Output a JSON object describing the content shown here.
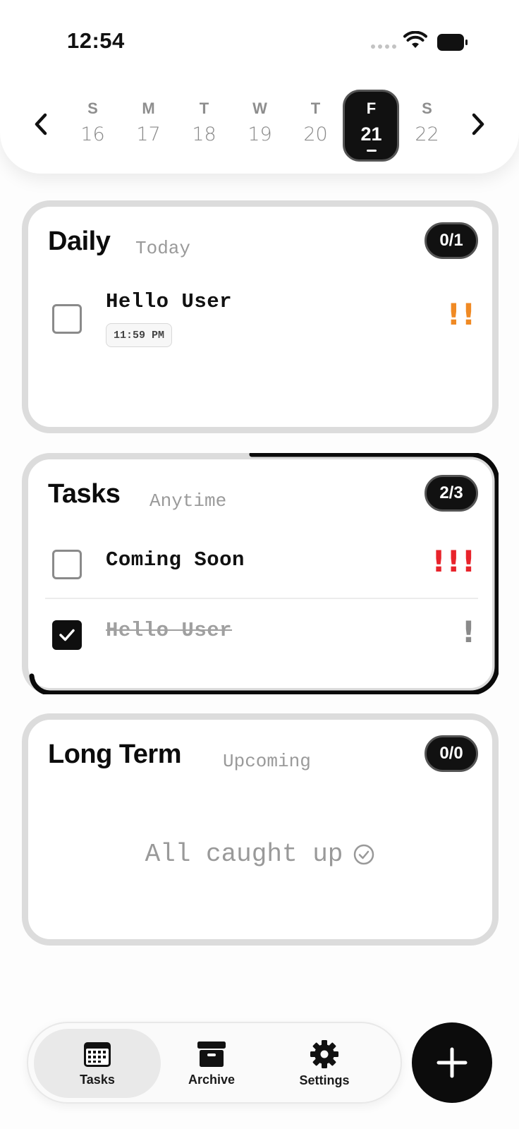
{
  "status_bar": {
    "time": "12:54"
  },
  "week": {
    "days": [
      {
        "letter": "S",
        "num": "16"
      },
      {
        "letter": "M",
        "num": "17"
      },
      {
        "letter": "T",
        "num": "18"
      },
      {
        "letter": "W",
        "num": "19"
      },
      {
        "letter": "T",
        "num": "20"
      },
      {
        "letter": "F",
        "num": "21",
        "selected": true
      },
      {
        "letter": "S",
        "num": "22"
      }
    ]
  },
  "sections": [
    {
      "title": "Daily",
      "subtitle": "Today",
      "count": "0/1",
      "tasks": [
        {
          "title": "Hello User",
          "time": "11:59 PM",
          "priority": "!!",
          "priority_color": "#f08a24",
          "done": false
        }
      ]
    },
    {
      "title": "Tasks",
      "subtitle": "Anytime",
      "count": "2/3",
      "tasks": [
        {
          "title": "Coming Soon",
          "priority": "!!!",
          "priority_color": "#e8232b",
          "done": false
        },
        {
          "title": "Hello User",
          "priority": "!",
          "priority_color": "#8a8a8a",
          "done": true
        }
      ]
    },
    {
      "title": "Long Term",
      "subtitle": "Upcoming",
      "count": "0/0",
      "empty_text": "All caught up"
    }
  ],
  "tabbar": {
    "tabs": [
      {
        "label": "Tasks",
        "icon": "calendar-icon",
        "active": true
      },
      {
        "label": "Archive",
        "icon": "archive-box-icon"
      },
      {
        "label": "Settings",
        "icon": "gear-icon"
      }
    ]
  },
  "fab": {
    "icon": "plus-icon"
  },
  "colors": {
    "accent": "#111111",
    "priority_high": "#e8232b",
    "priority_medium": "#f08a24",
    "priority_low": "#8a8a8a"
  }
}
